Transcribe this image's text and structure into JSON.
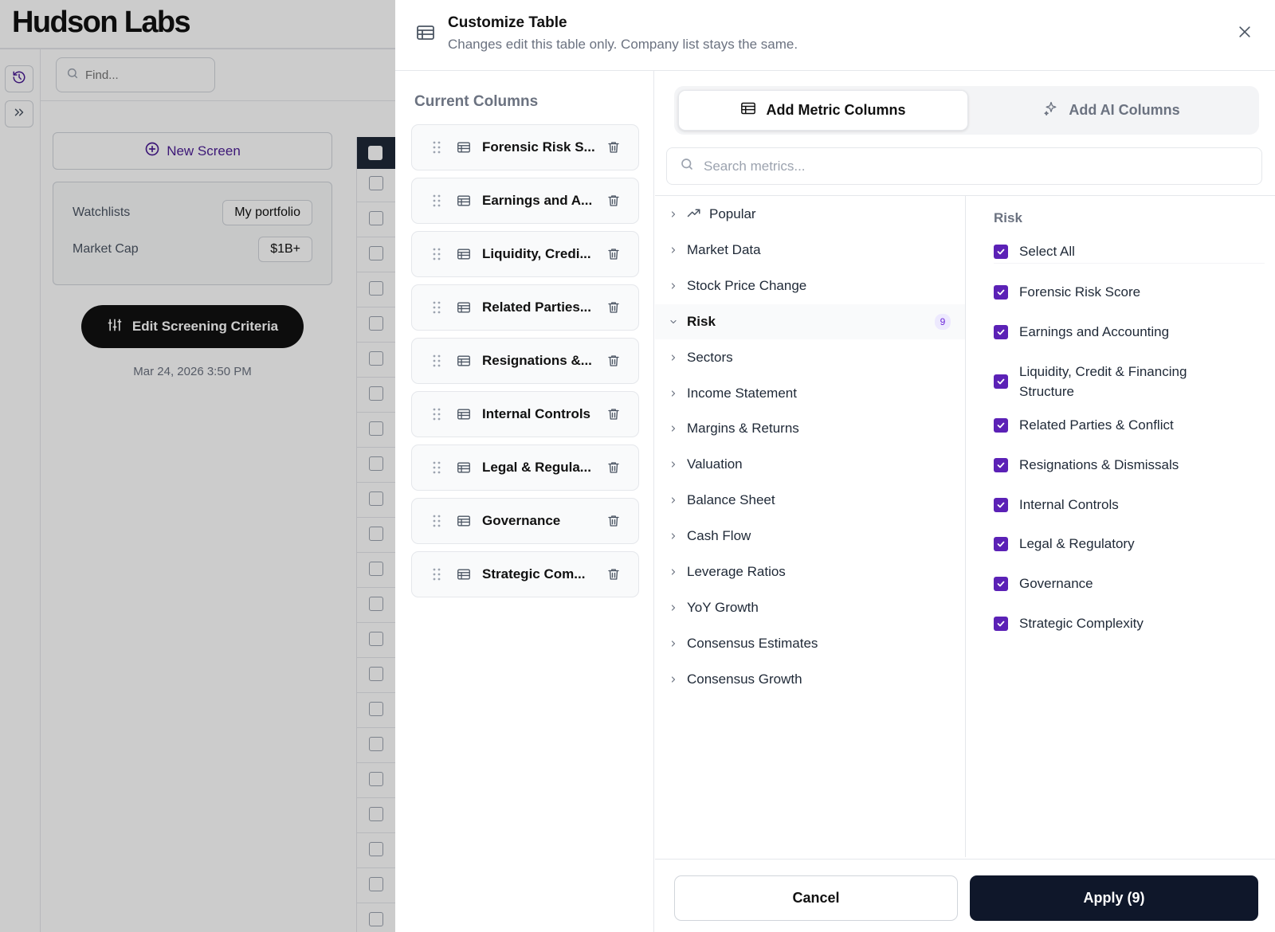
{
  "app": {
    "logo": "Hudson Labs",
    "find_placeholder": "Find...",
    "new_screen_label": "New Screen",
    "criteria": [
      {
        "label": "Watchlists",
        "value": "My portfolio"
      },
      {
        "label": "Market Cap",
        "value": "$1B+"
      }
    ],
    "edit_button_label": "Edit Screening Criteria",
    "timestamp": "Mar 24, 2026 3:50 PM"
  },
  "panel": {
    "title": "Customize Table",
    "subtitle": "Changes edit this table only. Company list stays the same.",
    "current_columns_title": "Current Columns",
    "current_columns": [
      "Forensic Risk S...",
      "Earnings and A...",
      "Liquidity, Credi...",
      "Related Parties...",
      "Resignations &...",
      "Internal Controls",
      "Legal & Regula...",
      "Governance",
      "Strategic Com..."
    ],
    "tabs": [
      {
        "label": "Add Metric Columns",
        "active": true
      },
      {
        "label": "Add AI Columns",
        "active": false
      }
    ],
    "search_placeholder": "Search metrics...",
    "categories": [
      {
        "label": "Popular",
        "icon": "trending-up-icon",
        "expanded": false
      },
      {
        "label": "Market Data",
        "expanded": false
      },
      {
        "label": "Stock Price Change",
        "expanded": false
      },
      {
        "label": "Risk",
        "expanded": true,
        "count": "9"
      },
      {
        "label": "Sectors",
        "expanded": false
      },
      {
        "label": "Income Statement",
        "expanded": false
      },
      {
        "label": "Margins & Returns",
        "expanded": false
      },
      {
        "label": "Valuation",
        "expanded": false
      },
      {
        "label": "Balance Sheet",
        "expanded": false
      },
      {
        "label": "Cash Flow",
        "expanded": false
      },
      {
        "label": "Leverage Ratios",
        "expanded": false
      },
      {
        "label": "YoY Growth",
        "expanded": false
      },
      {
        "label": "Consensus Estimates",
        "expanded": false
      },
      {
        "label": "Consensus Growth",
        "expanded": false
      }
    ],
    "detail": {
      "title": "Risk",
      "select_all_label": "Select All",
      "items": [
        {
          "label": "Forensic Risk Score",
          "checked": true
        },
        {
          "label": "Earnings and Accounting",
          "checked": true
        },
        {
          "label": "Liquidity, Credit & Financing Structure",
          "checked": true
        },
        {
          "label": "Related Parties & Conflict",
          "checked": true
        },
        {
          "label": "Resignations & Dismissals",
          "checked": true
        },
        {
          "label": "Internal Controls",
          "checked": true
        },
        {
          "label": "Legal & Regulatory",
          "checked": true
        },
        {
          "label": "Governance",
          "checked": true
        },
        {
          "label": "Strategic Complexity",
          "checked": true
        }
      ]
    },
    "cancel_label": "Cancel",
    "apply_label": "Apply (9)"
  },
  "colors": {
    "accent": "#5b21b6",
    "apply_bg": "#0f172a",
    "edit_bg": "#111111"
  }
}
